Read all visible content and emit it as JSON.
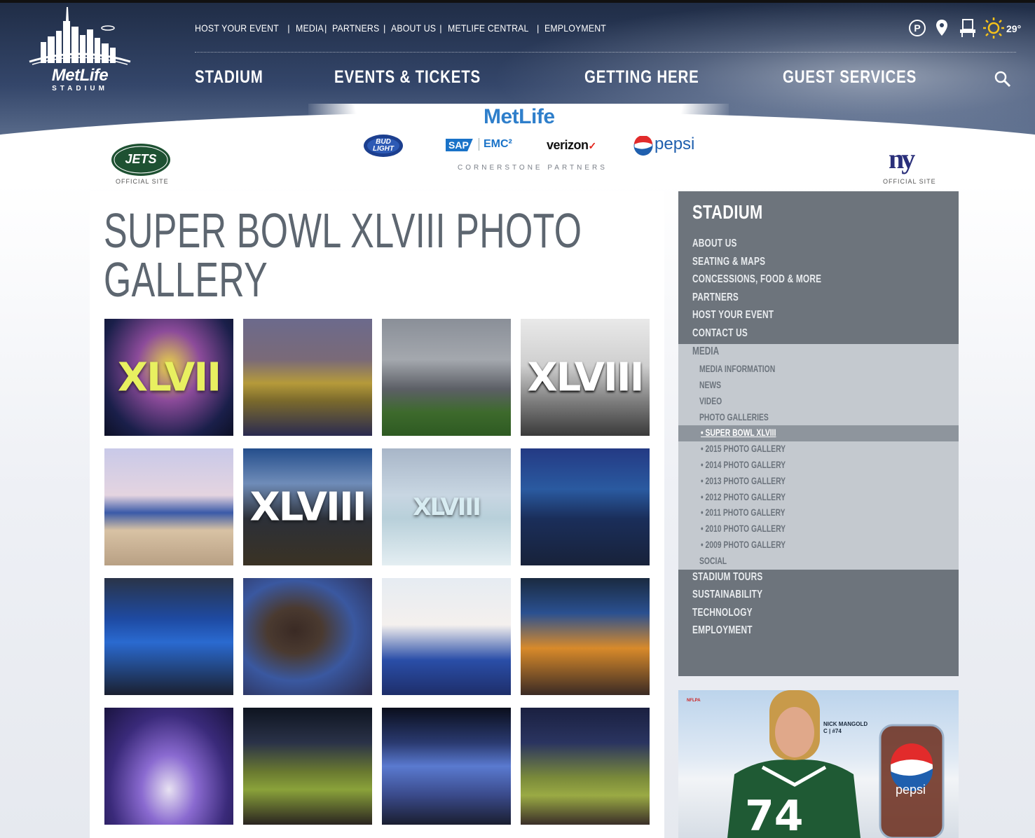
{
  "header": {
    "logo_name": "MetLife",
    "logo_sub": "STADIUM",
    "utility_links": [
      "HOST YOUR EVENT",
      "MEDIA",
      "PARTNERS",
      "ABOUT US",
      "METLIFE CENTRAL",
      "EMPLOYMENT"
    ],
    "main_nav": [
      "STADIUM",
      "EVENTS & TICKETS",
      "GETTING HERE",
      "GUEST SERVICES"
    ],
    "weather_temp": "29°",
    "icons": [
      "parking-icon",
      "location-pin-icon",
      "seat-icon",
      "sun-icon",
      "search-icon"
    ]
  },
  "sponsors": {
    "metlife": "MetLife",
    "sap": "SAP",
    "emc": "EMC²",
    "verizon": "verizon",
    "verizon_check": "✓",
    "pepsi": "pepsi",
    "cornerstone": "CORNERSTONE    PARTNERS",
    "jets_official": "OFFICIAL SITE",
    "giants_logo": "ny",
    "giants_official": "OFFICIAL SITE"
  },
  "page": {
    "title_line1": "SUPER BOWL XLVIII PHOTO",
    "title_line2": "GALLERY"
  },
  "gallery": {
    "captions": [
      "XLVII",
      "",
      "",
      "XLVIII",
      "",
      "XLVIII",
      "XLVIII",
      "",
      "",
      "",
      "",
      "",
      "",
      "",
      "",
      ""
    ]
  },
  "sidebar": {
    "title": "STADIUM",
    "top_links": [
      "ABOUT US",
      "SEATING & MAPS",
      "CONCESSIONS, FOOD & MORE",
      "PARTNERS",
      "HOST YOUR EVENT",
      "CONTACT US"
    ],
    "media_label": "MEDIA",
    "media_sub": [
      "MEDIA INFORMATION",
      "NEWS",
      "VIDEO",
      "PHOTO GALLERIES"
    ],
    "active_gallery": "• SUPER BOWL XLVIII",
    "galleries": [
      "• 2015 PHOTO GALLERY",
      "• 2014 PHOTO GALLERY",
      "• 2013 PHOTO GALLERY",
      "• 2012 PHOTO GALLERY",
      "• 2011 PHOTO GALLERY",
      "• 2010 PHOTO GALLERY",
      "• 2009 PHOTO GALLERY"
    ],
    "social": "SOCIAL",
    "bottom_links": [
      "STADIUM TOURS",
      "SUSTAINABILITY",
      "TECHNOLOGY",
      "EMPLOYMENT"
    ]
  },
  "ad": {
    "nflpa": "NFLPA",
    "player_name": "NICK MANGOLD",
    "player_pos": "C | #74",
    "jersey_number": "74",
    "brand": "pepsi"
  }
}
